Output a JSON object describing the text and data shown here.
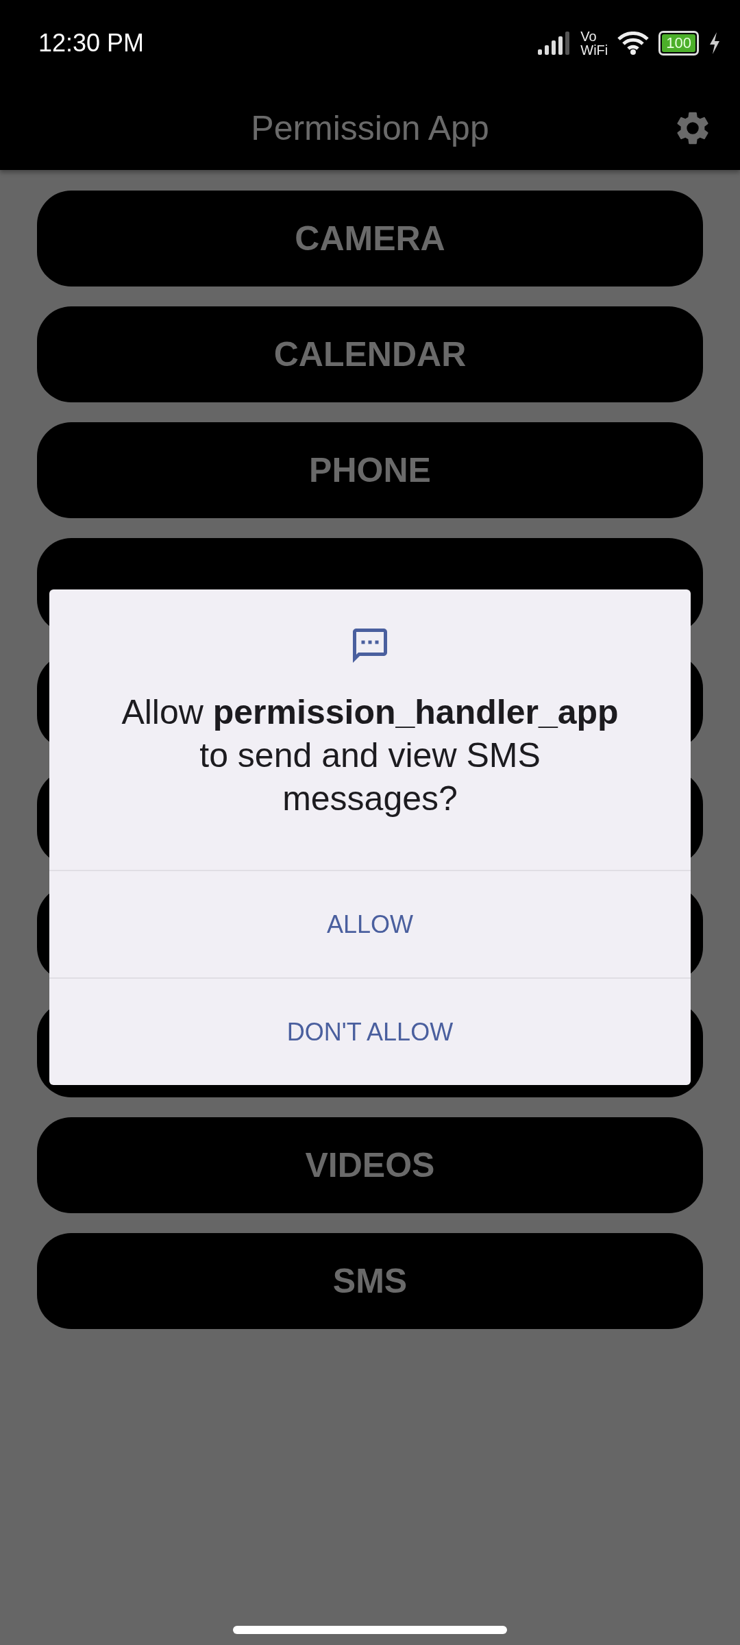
{
  "status_bar": {
    "time": "12:30 PM",
    "vo": "Vo",
    "wifi_label": "WiFi",
    "battery": "100",
    "charging": true
  },
  "app_bar": {
    "title": "Permission App"
  },
  "buttons": [
    {
      "kind": "labeled",
      "label": "CAMERA"
    },
    {
      "kind": "labeled",
      "label": "CALENDAR"
    },
    {
      "kind": "labeled",
      "label": "PHONE"
    },
    {
      "kind": "covered"
    },
    {
      "kind": "covered"
    },
    {
      "kind": "covered"
    },
    {
      "kind": "covered"
    },
    {
      "kind": "covered"
    },
    {
      "kind": "labeled",
      "label": "VIDEOS"
    },
    {
      "kind": "labeled",
      "label": "SMS"
    }
  ],
  "dialog": {
    "message": "Allow **permission_handler_app** to send and view SMS messages?",
    "actions": [
      "ALLOW",
      "DON'T ALLOW"
    ]
  }
}
